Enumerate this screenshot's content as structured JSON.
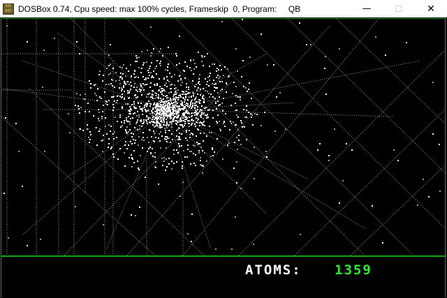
{
  "window": {
    "icon_text": "DOS BOX",
    "title": "DOSBox 0.74, Cpu speed: max 100% cycles, Frameskip  0, Program:     QB",
    "minimize_glyph": "—",
    "maximize_glyph": "☐",
    "close_glyph": "✕"
  },
  "status": {
    "atoms_label": "ATOMS:",
    "atoms_count": "1359"
  },
  "colors": {
    "border_green": "#0fa80f",
    "count_green": "#27ee27",
    "particle_white": "#ffffff",
    "trail_gray": "#9a9a9a"
  }
}
